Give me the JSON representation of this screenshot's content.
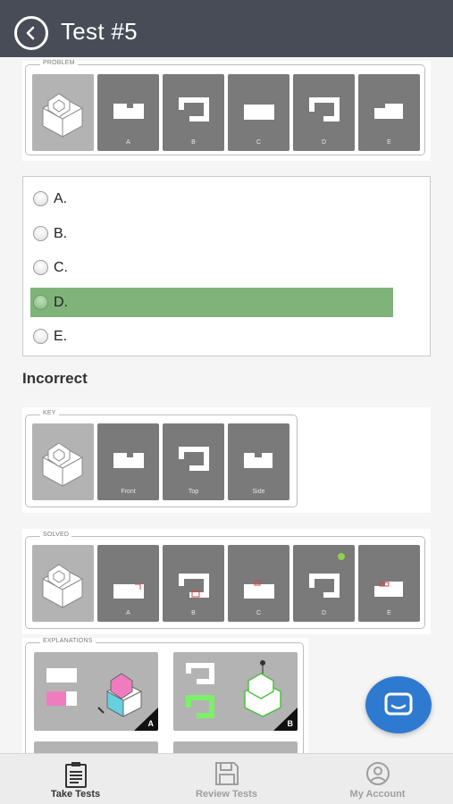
{
  "header": {
    "title": "Test #5",
    "back_icon": "chevron-left-icon"
  },
  "problem": {
    "legend": "PROBLEM",
    "tiles": [
      "",
      "A",
      "B",
      "C",
      "D",
      "E"
    ]
  },
  "answers": {
    "options": [
      {
        "label": "A.",
        "selected": false
      },
      {
        "label": "B.",
        "selected": false
      },
      {
        "label": "C.",
        "selected": false
      },
      {
        "label": "D.",
        "selected": true
      },
      {
        "label": "E.",
        "selected": false
      }
    ],
    "selected_color": "#7fb37a"
  },
  "result": {
    "text": "Incorrect"
  },
  "key": {
    "legend": "KEY",
    "tiles": [
      "",
      "Front",
      "Top",
      "Side"
    ]
  },
  "solved": {
    "legend": "SOLVED",
    "tiles": [
      "",
      "A",
      "B",
      "C",
      "D",
      "E"
    ],
    "correct_marker_color": "#8fd14f"
  },
  "explanations": {
    "legend": "EXPLANATIONS",
    "cards": [
      "A",
      "B"
    ]
  },
  "tabbar": {
    "tabs": [
      {
        "label": "Take Tests",
        "icon": "clipboard-icon",
        "active": true
      },
      {
        "label": "Review Tests",
        "icon": "floppy-disk-icon",
        "active": false
      },
      {
        "label": "My Account",
        "icon": "user-circle-icon",
        "active": false
      }
    ]
  },
  "fab": {
    "icon": "chat-icon",
    "color": "#2f7ad1"
  }
}
